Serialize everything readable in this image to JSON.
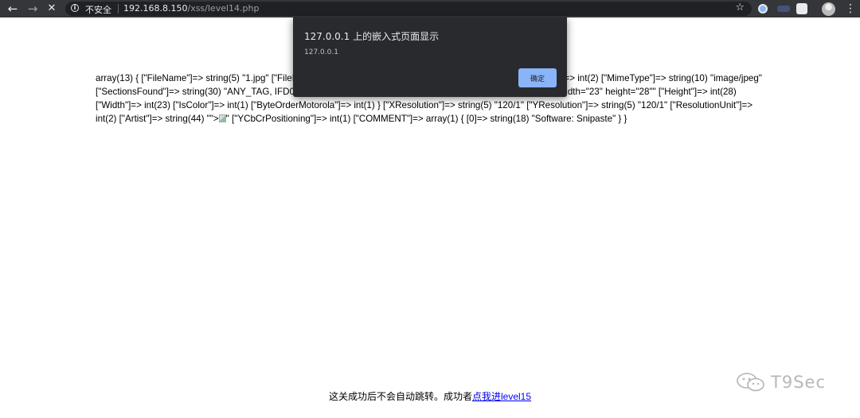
{
  "browser": {
    "back_icon": "←",
    "forward_icon": "→",
    "stop_icon": "✕",
    "security_label": "不安全",
    "url_host": "192.168.8.150",
    "url_path": "/xss/level14.php",
    "star_icon": "☆",
    "menu_icon": "⋮"
  },
  "content": {
    "dump_part1": "array(13) { [\"FileName\"]=> string(5) \"1.jpg\" [\"FileDateTime\"]=> int(1701500042) [\"FileSize\"]=> int(8432) [\"FileType\"]=> int(2) [\"MimeType\"]=> string(10) \"image/jpeg\" [\"SectionsFound\"]=> string(30) \"ANY_TAG, IFD0, COMMENT\" [\"COMPUTED\"]=> array(5) { [\"html\"]=> string(22) \"width=\"23\" height=\"28\"\" [\"Height\"]=> int(28) [\"Width\"]=> int(23) [\"IsColor\"]=> int(1) [\"ByteOrderMotorola\"]=> int(1) } [\"XResolution\"]=> string(5) \"120/1\" [\"YResolution\"]=> string(5) \"120/1\" [\"ResolutionUnit\"]=> int(2) [\"Artist\"]=> string(44) \"\">",
    "dump_part2": "\" [\"YCbCrPositioning\"]=> int(1) [\"COMMENT\"]=> array(1) { [0]=> string(18) \"Software: Snipaste\" } }"
  },
  "dialog": {
    "title": "127.0.0.1 上的嵌入式页面显示",
    "message": "127.0.0.1",
    "ok_label": "确定"
  },
  "footer": {
    "text": "这关成功后不会自动跳转。成功者",
    "link_text": "点我进level15"
  },
  "watermark": {
    "text": "T9Sec"
  }
}
